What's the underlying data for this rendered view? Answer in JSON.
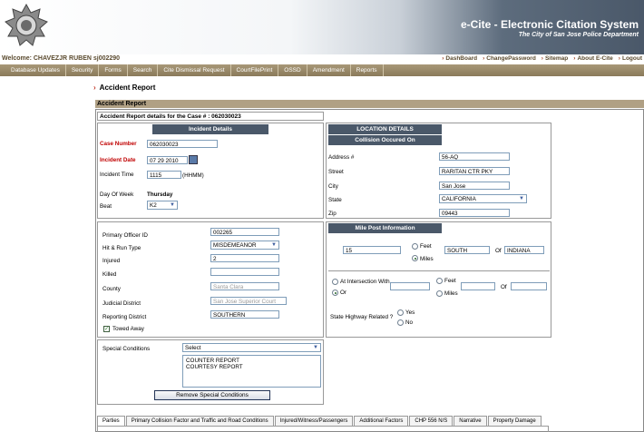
{
  "header": {
    "app_title": "e-Cite - Electronic Citation System",
    "app_subtitle": "The City of San Jose Police Department"
  },
  "welcome": "Welcome: CHAVEZJR RUBEN sj002290",
  "top_links": [
    "DashBoard",
    "ChangePassword",
    "Sitemap",
    "About E-Cite",
    "Logout"
  ],
  "menu": [
    "Database Updates",
    "Security",
    "Forms",
    "Search",
    "Cite Dismissal Request",
    "CourtFilePrint",
    "OSSD",
    "Amendment",
    "Reports"
  ],
  "breadcrumb": "Accident Report",
  "section_title": "Accident Report",
  "case_header": "Accident Report details for the Case # : 062030023",
  "incident": {
    "title": "Incident Details",
    "case_number_label": "Case Number",
    "case_number": "062030023",
    "incident_date_label": "Incident Date",
    "incident_date": "07 29 2010",
    "incident_time_label": "Incident Time",
    "incident_time": "1115",
    "time_hint": "(HHMM)",
    "day_label": "Day Of Week",
    "day_value": "Thursday",
    "beat_label": "Beat",
    "beat_value": "K2"
  },
  "location": {
    "title": "LOCATION DETAILS",
    "subtitle": "Collision Occured On",
    "address_label": "Address #",
    "address": "56-AQ",
    "street_label": "Street",
    "street": "RARITAN CTR PKY",
    "city_label": "City",
    "city": "San Jose",
    "state_label": "State",
    "state": "CALIFORNIA",
    "zip_label": "Zip",
    "zip": "09443"
  },
  "officer": {
    "primary_officer_label": "Primary Officer ID",
    "primary_officer": "002265",
    "hit_run_label": "Hit & Run Type",
    "hit_run": "MISDEMEANOR",
    "injured_label": "Injured",
    "injured": "2",
    "killed_label": "Killed",
    "killed": "",
    "county_label": "County",
    "county": "Santa Clara",
    "judicial_label": "Judicial District",
    "judicial": "San Jose Superior Court",
    "reporting_label": "Reporting District",
    "reporting": "SOUTHERN",
    "towed_label": "Towed Away"
  },
  "milepost": {
    "title": "Mile Post Information",
    "value": "15",
    "feet_label": "Feet",
    "miles_label": "Miles",
    "direction": "SOUTH",
    "of_label": "Of",
    "of_value": "INDIANA",
    "intersection_label": "At Intersection With",
    "or_label": "Or",
    "feet2_label": "Feet",
    "miles2_label": "Miles",
    "of2_label": "Of",
    "highway_label": "State Highway Related ?",
    "yes_label": "Yes",
    "no_label": "No"
  },
  "special": {
    "label": "Special Conditions",
    "select_value": "Select",
    "items": [
      "COUNTER REPORT",
      "COURTESY REPORT"
    ],
    "remove_button": "Remove Special Conditions"
  },
  "tabs": [
    "Parties",
    "Primary Collision Factor and Traffic and Road Conditions",
    "Injured/Witness/Passengers",
    "Additional Factors",
    "CHP 556 N/S",
    "Narrative",
    "Property Damage"
  ]
}
